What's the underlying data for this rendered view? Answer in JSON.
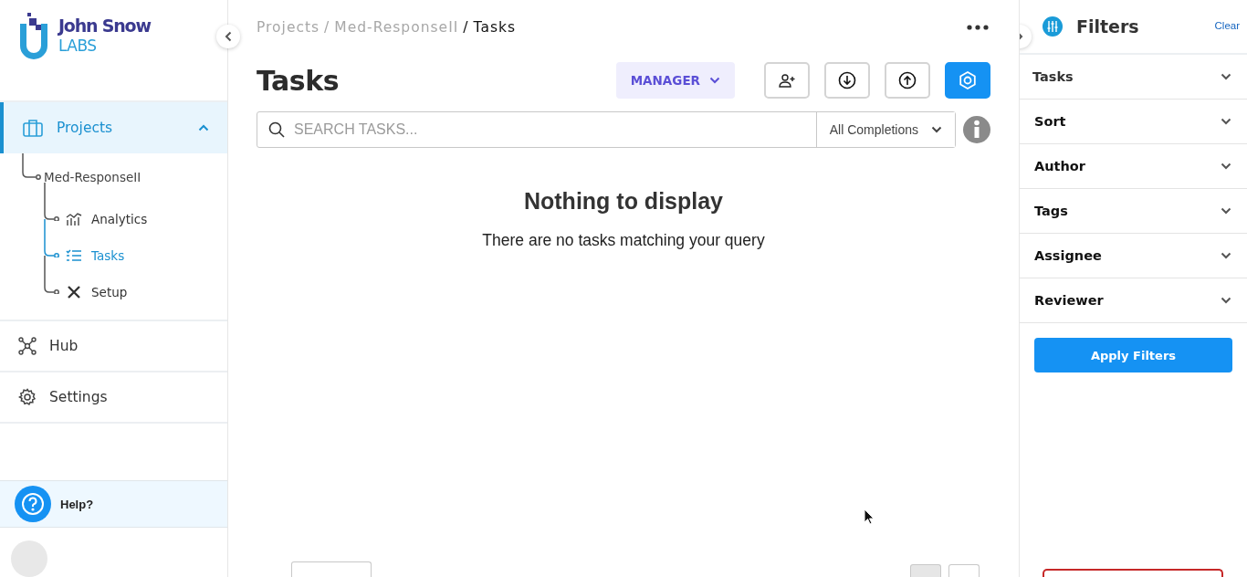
{
  "logo": {
    "name": "John Snow",
    "sub": "LABS"
  },
  "nav": [
    {
      "label": "Projects",
      "selected": true,
      "expanded": true,
      "children": [
        {
          "label": "Med-ResponseII",
          "children": [
            {
              "label": "Analytics",
              "selected": false
            },
            {
              "label": "Tasks",
              "selected": true
            },
            {
              "label": "Setup",
              "selected": false
            }
          ]
        }
      ]
    },
    {
      "label": "Hub",
      "selected": false
    },
    {
      "label": "Settings",
      "selected": false
    }
  ],
  "help": {
    "label": "Help?"
  },
  "breadcrumb": {
    "items": [
      "Projects",
      "Med-ResponseII",
      "Tasks"
    ],
    "separator": "/"
  },
  "page_title": "Tasks",
  "role_button": {
    "label": "MANAGER"
  },
  "toolbar_buttons": [
    {
      "kind": "add-user",
      "selected": false
    },
    {
      "kind": "download",
      "selected": false
    },
    {
      "kind": "upload",
      "selected": false
    },
    {
      "kind": "settings",
      "selected": true
    }
  ],
  "search": {
    "placeholder": "SEARCH TASKS..."
  },
  "completion_filter": {
    "value": "All Completions"
  },
  "empty_state": {
    "title": "Nothing to display",
    "message": "There are no tasks matching your query"
  },
  "filters": {
    "title": "Filters",
    "clear": "Clear",
    "sections": [
      "Tasks",
      "Sort",
      "Author",
      "Tags",
      "Assignee",
      "Reviewer"
    ],
    "apply": "Apply Filters"
  }
}
